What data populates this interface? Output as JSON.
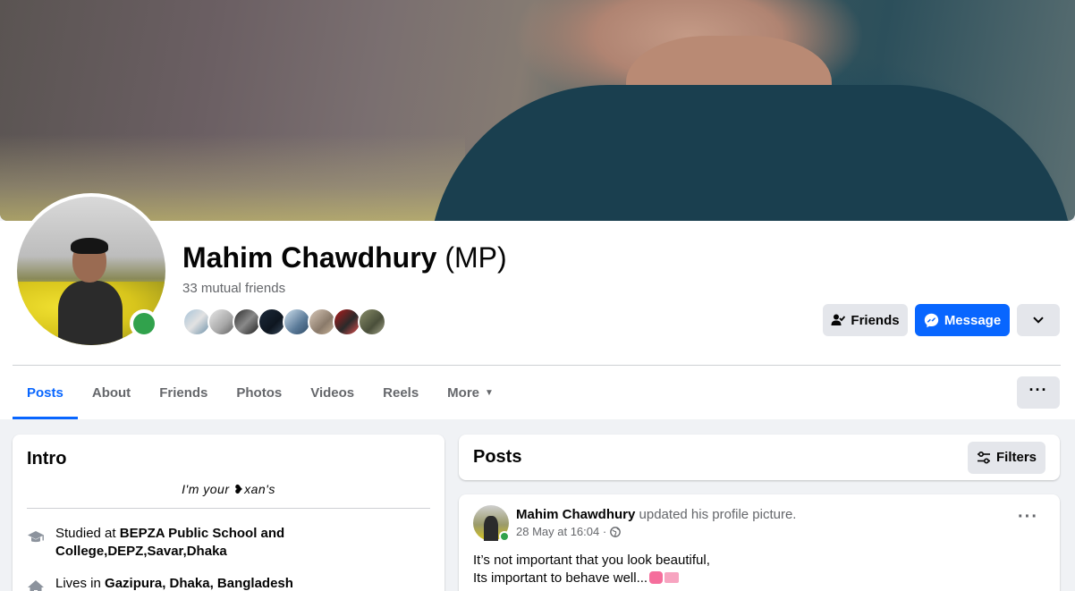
{
  "profile": {
    "name": "Mahim Chawdhury",
    "nickname": "(MP)",
    "mutual_friends": "33 mutual friends",
    "mutual_avatar_count": 8
  },
  "actions": {
    "friends_label": "Friends",
    "message_label": "Message"
  },
  "tabs": [
    {
      "label": "Posts",
      "active": true
    },
    {
      "label": "About"
    },
    {
      "label": "Friends"
    },
    {
      "label": "Photos"
    },
    {
      "label": "Videos"
    },
    {
      "label": "Reels"
    },
    {
      "label": "More"
    }
  ],
  "intro": {
    "title": "Intro",
    "bio": "I'm your ❥xan's",
    "studied_prefix": "Studied at",
    "studied_place": "BEPZA Public School and College,DEPZ,Savar,Dhaka",
    "lives_prefix": "Lives in",
    "lives_place": "Gazipura, Dhaka, Bangladesh"
  },
  "posts": {
    "title": "Posts",
    "filters_label": "Filters",
    "items": [
      {
        "author": "Mahim Chawdhury",
        "action": "updated his profile picture.",
        "time": "28 May at 16:04 ·",
        "line1": "It’s not important that you look beautiful,",
        "line2": "Its important to behave well..."
      }
    ]
  },
  "colors": {
    "accent": "#0866ff",
    "online": "#31a24c",
    "secondary_text": "#65676b",
    "button_grey": "#e4e6eb"
  }
}
